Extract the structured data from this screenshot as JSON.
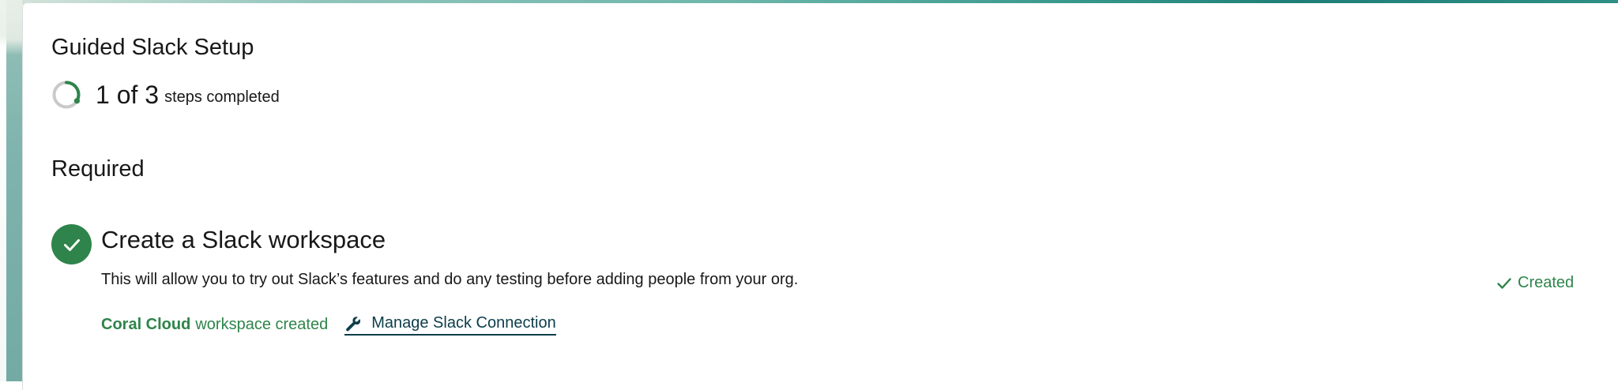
{
  "colors": {
    "success": "#2e844a",
    "link": "#0b3d4a",
    "text": "#181818",
    "ring_track": "#c9c9c9"
  },
  "setup": {
    "title": "Guided Slack Setup",
    "progress": {
      "count_text": "1 of 3",
      "suffix_text": "steps completed",
      "completed": 1,
      "total": 3
    }
  },
  "required": {
    "heading": "Required",
    "steps": [
      {
        "status_icon": "check-icon",
        "title": "Create a Slack workspace",
        "description": "This will allow you to try out Slack’s features and do any testing before adding people from your org.",
        "state_icon": "check-icon",
        "state_label": "Created",
        "workspace_name": "Coral Cloud",
        "workspace_status": "workspace created",
        "action_icon": "wrench-icon",
        "action_label": "Manage Slack Connection"
      }
    ]
  }
}
